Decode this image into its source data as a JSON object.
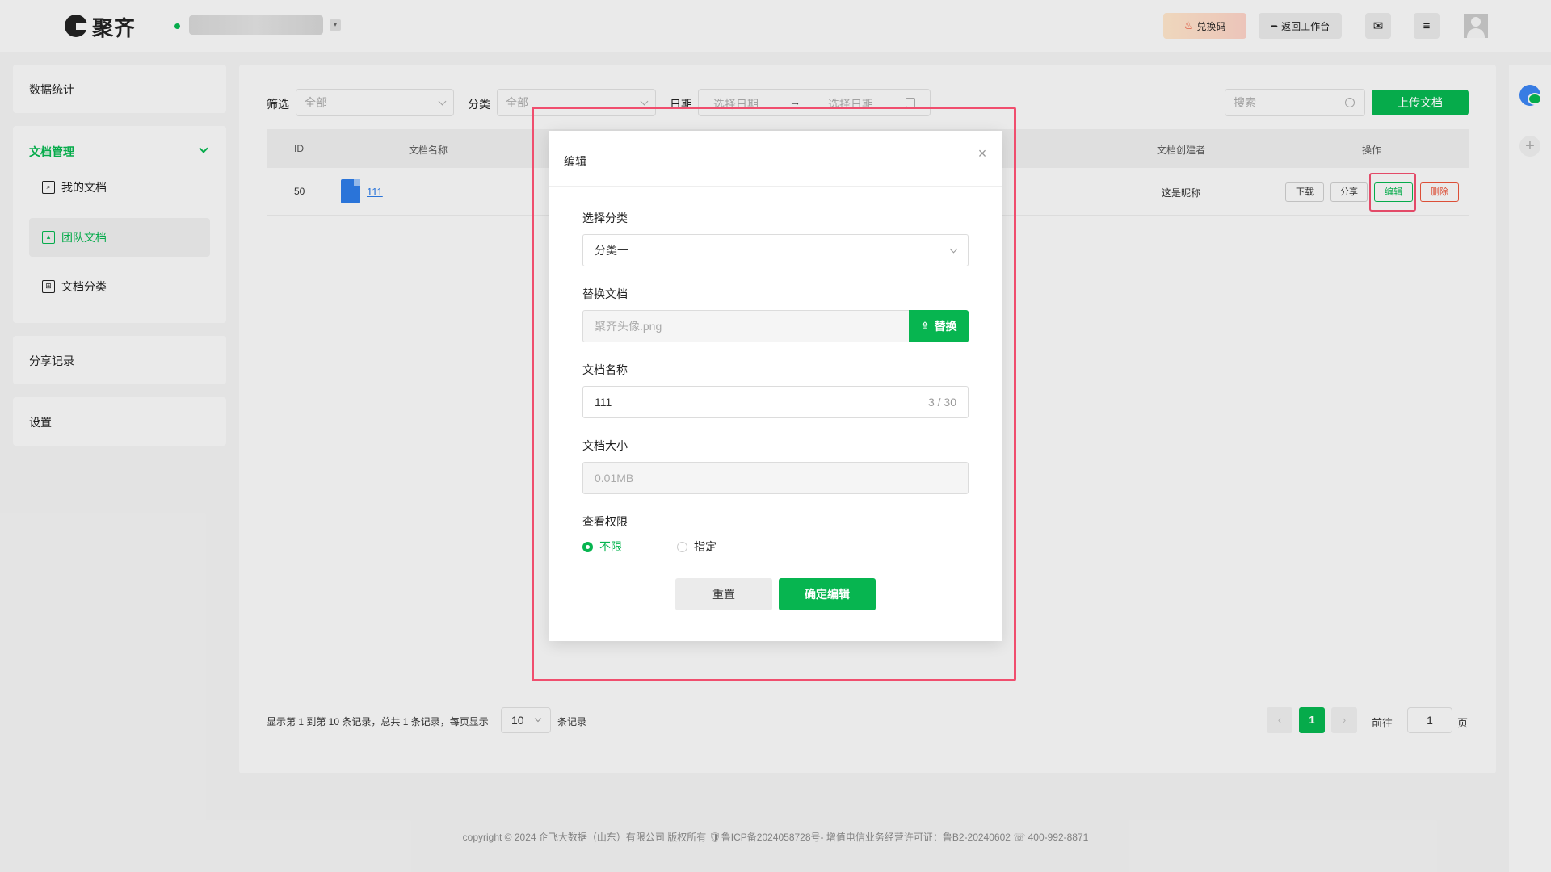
{
  "header": {
    "logo_text": "聚齐",
    "redeem_label": "兑换码",
    "workspace_label": "返回工作台",
    "icons": [
      "mail-icon",
      "menu-icon",
      "avatar"
    ]
  },
  "sidebar": {
    "stats": "数据统计",
    "doc_mgmt": "文档管理",
    "items": [
      {
        "label": "我的文档",
        "icon": "my-docs-icon"
      },
      {
        "label": "团队文档",
        "icon": "team-docs-icon"
      },
      {
        "label": "文档分类",
        "icon": "category-grid-icon"
      }
    ],
    "share_records": "分享记录",
    "settings": "设置"
  },
  "filters": {
    "filter_label": "筛选",
    "filter_value": "全部",
    "category_label": "分类",
    "category_value": "全部",
    "date_label": "日期",
    "date_start": "选择日期",
    "date_sep": "→",
    "date_end": "选择日期",
    "search_placeholder": "搜索",
    "upload_label": "上传文档"
  },
  "table": {
    "headers": {
      "id": "ID",
      "name": "文档名称",
      "creator": "文档创建者",
      "actions": "操作"
    },
    "row": {
      "id": "50",
      "name": "111",
      "creator": "这是昵称",
      "actions": {
        "download": "下载",
        "share": "分享",
        "edit": "编辑",
        "delete": "删除"
      }
    }
  },
  "pagination": {
    "info": "显示第 1 到第 10 条记录，总共 1 条记录，每页显示",
    "page_size": "10",
    "unit": "条记录",
    "prev": "‹",
    "current": "1",
    "next": "›",
    "goto_label": "前往",
    "goto_value": "1",
    "page_label": "页"
  },
  "footer": {
    "text": "copyright © 2024 企飞大数据（山东）有限公司 版权所有   🛡鲁ICP备2024058728号-   增值电信业务经营许可证：鲁B2-20240602 ☏ 400-992-8871"
  },
  "dialog": {
    "title": "编辑",
    "close": "×",
    "category_label": "选择分类",
    "category_value": "分类一",
    "replace_label": "替换文档",
    "file_name": "聚齐头像.png",
    "replace_button": "替换",
    "name_label": "文档名称",
    "name_value": "111",
    "name_count": "3 / 30",
    "size_label": "文档大小",
    "size_value": "0.01MB",
    "perm_label": "查看权限",
    "perm_unlimited": "不限",
    "perm_specified": "指定",
    "reset_label": "重置",
    "confirm_label": "确定编辑"
  },
  "colors": {
    "accent": "#07b550",
    "danger": "#e8543a",
    "highlight": "#f04e6e",
    "link": "#2d7be5"
  }
}
